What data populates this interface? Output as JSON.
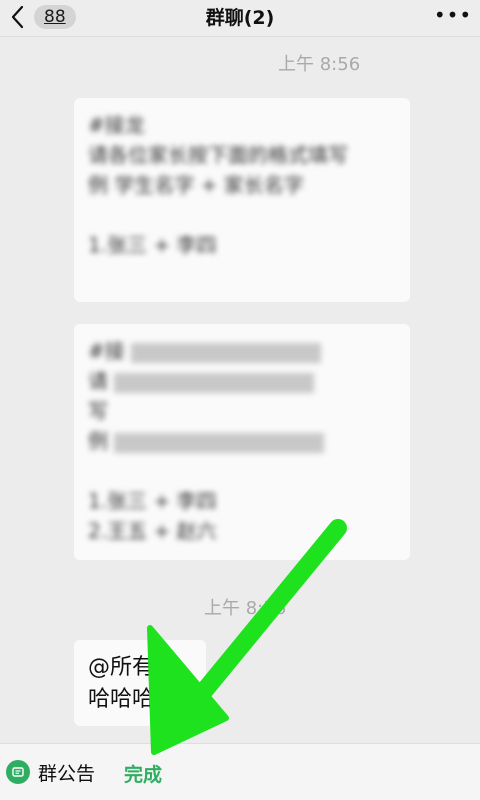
{
  "header": {
    "back_badge": "88",
    "title": "群聊(2)",
    "more_label": "•••"
  },
  "messages": {
    "timestamp_1": "上午 8:56",
    "timestamp_2": "上午 8:56",
    "notice_card_1": {
      "lines": [
        "#接龙",
        "请各位家长按下面的格式填写",
        "例 学生名字 + 家长名字",
        "",
        "1.张三 + 李四"
      ]
    },
    "notice_card_2": {
      "lines": [
        "#接",
        "请",
        "写",
        "例",
        "",
        "1.张三 + 李四",
        "2.王五 + 赵六"
      ]
    },
    "bubble_line_1": "@所有人",
    "bubble_line_2": "哈哈哈哈"
  },
  "bottom_bar": {
    "notice_label": "群公告",
    "done_label": "完成"
  },
  "colors": {
    "accent_green": "#2fae62",
    "arrow_green": "#1ee21e"
  }
}
